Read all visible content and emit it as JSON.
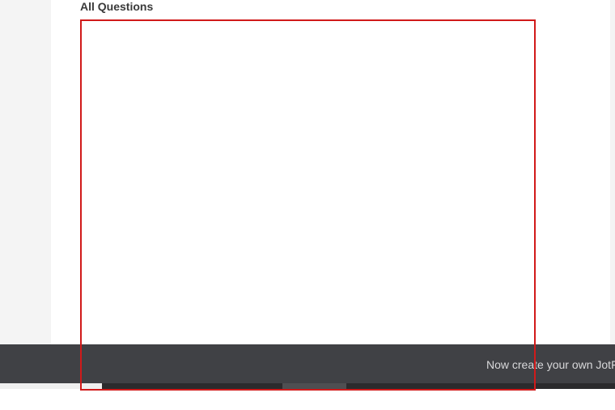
{
  "section": {
    "title": "All Questions"
  },
  "footer": {
    "promo_text": "Now create your own JotF"
  },
  "colors": {
    "frame_border": "#d11a1a",
    "footer_background": "#404145",
    "gutter_background": "#f4f4f4"
  }
}
